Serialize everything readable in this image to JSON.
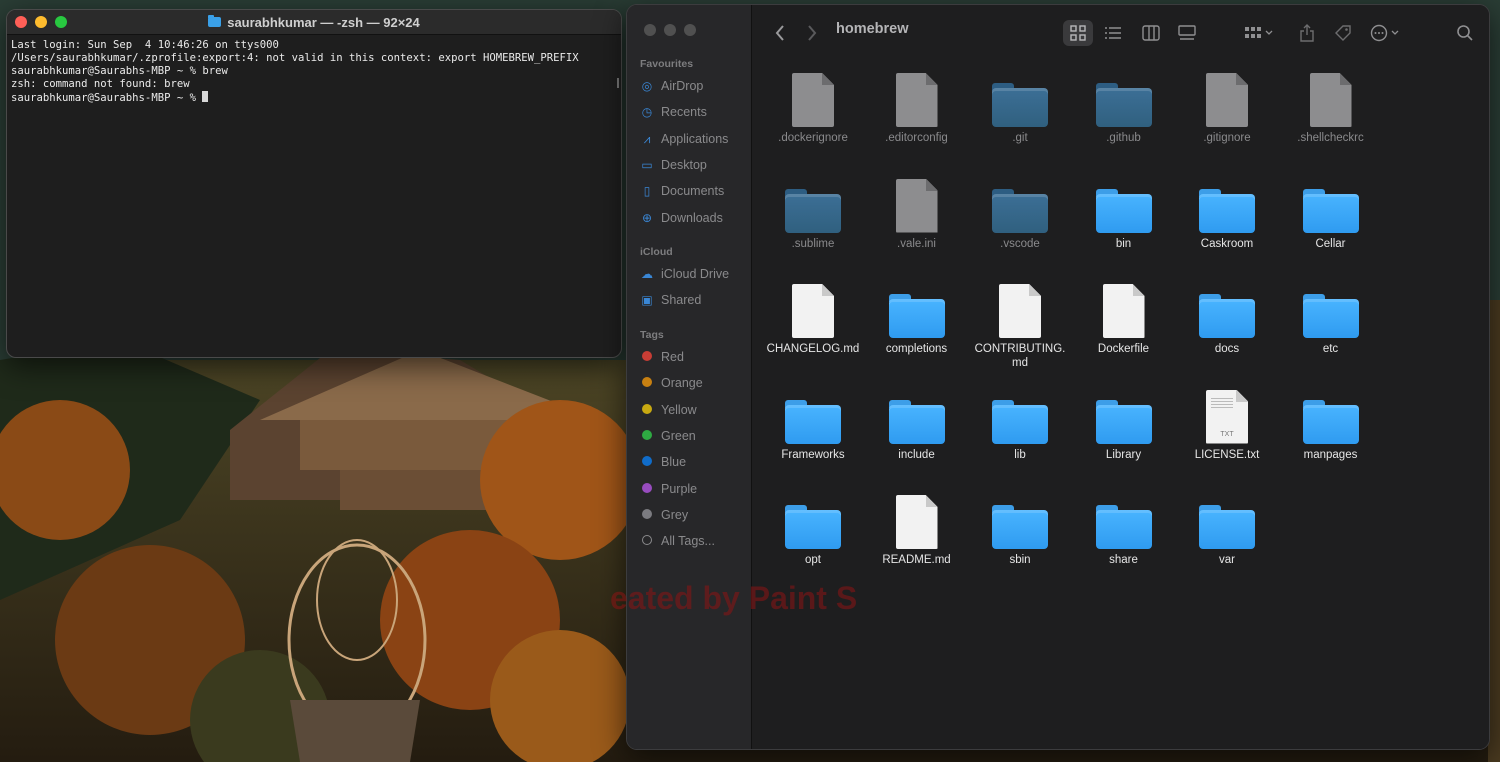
{
  "terminal": {
    "title": "saurabhkumar — -zsh — 92×24",
    "lines": [
      "Last login: Sun Sep  4 10:46:26 on ttys000",
      "/Users/saurabhkumar/.zprofile:export:4: not valid in this context: export HOMEBREW_PREFIX",
      "saurabhkumar@Saurabhs-MBP ~ % brew",
      "zsh: command not found: brew"
    ],
    "prompt": "saurabhkumar@Saurabhs-MBP ~ % "
  },
  "finder": {
    "path_title": "homebrew",
    "sidebar": {
      "favourites_header": "Favourites",
      "favourites": [
        {
          "label": "AirDrop",
          "icon": "airdrop-icon"
        },
        {
          "label": "Recents",
          "icon": "clock-icon"
        },
        {
          "label": "Applications",
          "icon": "applications-icon"
        },
        {
          "label": "Desktop",
          "icon": "desktop-icon"
        },
        {
          "label": "Documents",
          "icon": "document-icon"
        },
        {
          "label": "Downloads",
          "icon": "download-icon"
        }
      ],
      "icloud_header": "iCloud",
      "icloud": [
        {
          "label": "iCloud Drive",
          "icon": "cloud-icon"
        },
        {
          "label": "Shared",
          "icon": "shared-folder-icon"
        }
      ],
      "tags_header": "Tags",
      "tags": [
        {
          "label": "Red",
          "color": "#ff453a"
        },
        {
          "label": "Orange",
          "color": "#ff9f0a"
        },
        {
          "label": "Yellow",
          "color": "#ffd60a"
        },
        {
          "label": "Green",
          "color": "#32d74b"
        },
        {
          "label": "Blue",
          "color": "#0a84ff"
        },
        {
          "label": "Purple",
          "color": "#bf5af2"
        },
        {
          "label": "Grey",
          "color": "#98989d"
        }
      ],
      "all_tags": "All Tags..."
    },
    "items": [
      {
        "name": ".dockerignore",
        "kind": "doc",
        "hidden": true
      },
      {
        "name": ".editorconfig",
        "kind": "doc",
        "hidden": true
      },
      {
        "name": ".git",
        "kind": "folder",
        "hidden": true
      },
      {
        "name": ".github",
        "kind": "folder",
        "hidden": true
      },
      {
        "name": ".gitignore",
        "kind": "doc",
        "hidden": true
      },
      {
        "name": ".shellcheckrc",
        "kind": "doc",
        "hidden": true
      },
      {
        "name": ".sublime",
        "kind": "folder",
        "hidden": true
      },
      {
        "name": ".vale.ini",
        "kind": "doc",
        "hidden": true
      },
      {
        "name": ".vscode",
        "kind": "folder",
        "hidden": true
      },
      {
        "name": "bin",
        "kind": "folder",
        "hidden": false
      },
      {
        "name": "Caskroom",
        "kind": "folder",
        "hidden": false
      },
      {
        "name": "Cellar",
        "kind": "folder",
        "hidden": false
      },
      {
        "name": "CHANGELOG.md",
        "kind": "doc",
        "hidden": false
      },
      {
        "name": "completions",
        "kind": "folder",
        "hidden": false
      },
      {
        "name": "CONTRIBUTING.\nmd",
        "kind": "doc",
        "hidden": false
      },
      {
        "name": "Dockerfile",
        "kind": "doc",
        "hidden": false
      },
      {
        "name": "docs",
        "kind": "folder",
        "hidden": false
      },
      {
        "name": "etc",
        "kind": "folder",
        "hidden": false
      },
      {
        "name": "Frameworks",
        "kind": "folder",
        "hidden": false
      },
      {
        "name": "include",
        "kind": "folder",
        "hidden": false
      },
      {
        "name": "lib",
        "kind": "folder",
        "hidden": false
      },
      {
        "name": "Library",
        "kind": "folder",
        "hidden": false
      },
      {
        "name": "LICENSE.txt",
        "kind": "txt",
        "hidden": false,
        "ext_label": "TXT"
      },
      {
        "name": "manpages",
        "kind": "folder",
        "hidden": false
      },
      {
        "name": "opt",
        "kind": "folder",
        "hidden": false
      },
      {
        "name": "README.md",
        "kind": "doc",
        "hidden": false
      },
      {
        "name": "sbin",
        "kind": "folder",
        "hidden": false
      },
      {
        "name": "share",
        "kind": "folder",
        "hidden": false
      },
      {
        "name": "var",
        "kind": "folder",
        "hidden": false
      }
    ]
  },
  "watermark": "eated by Paint S"
}
